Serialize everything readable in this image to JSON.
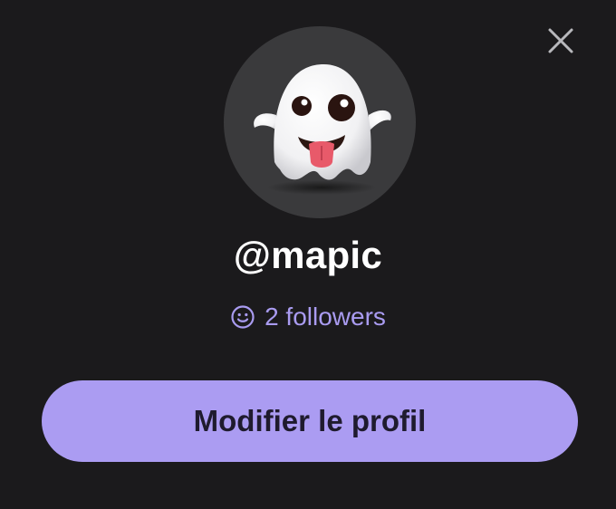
{
  "profile": {
    "handle": "@mapic",
    "followers_text": "2 followers",
    "avatar_icon": "ghost-emoji",
    "edit_button_label": "Modifier le profil"
  },
  "header": {
    "close_icon": "close-icon"
  },
  "colors": {
    "background": "#1b1a1c",
    "accent": "#ab9cf2",
    "followers_text": "#a99bf0",
    "avatar_bg": "#3a3a3c"
  }
}
